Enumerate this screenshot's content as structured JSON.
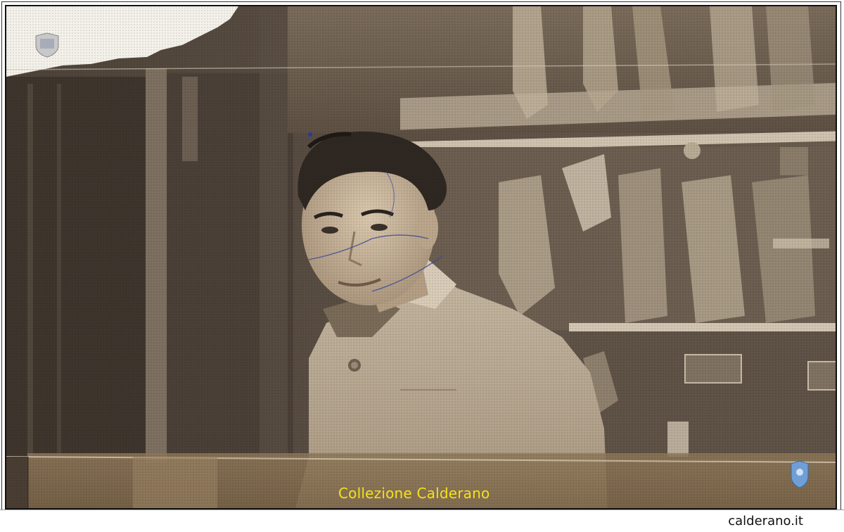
{
  "photo": {
    "caption_watermark": "Collezione Calderano"
  },
  "footer": {
    "site_url": "calderano.it"
  },
  "icons": {
    "top_left_emblem": "crest-icon",
    "bottom_right_emblem": "crest-icon"
  },
  "colors": {
    "watermark_text": "#f4e21a",
    "sepia_dark": "#4a3f35",
    "sepia_mid": "#8a7b68",
    "sepia_light": "#c9bba3"
  }
}
